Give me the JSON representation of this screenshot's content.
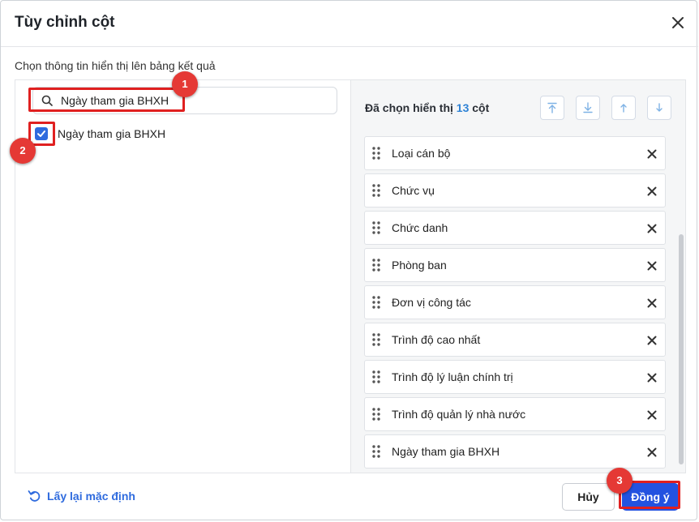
{
  "dialog": {
    "title": "Tùy chỉnh cột",
    "close_icon": "close-icon",
    "subtitle": "Chọn thông tin hiển thị lên bảng kết quả"
  },
  "left_panel": {
    "search": {
      "value": "Ngày tham gia BHXH",
      "icon": "search-icon"
    },
    "results": [
      {
        "label": "Ngày tham gia BHXH",
        "checked": true
      }
    ]
  },
  "right_panel": {
    "header_prefix": "Đã chọn hiển thị",
    "count": "13",
    "header_suffix": "cột",
    "move_buttons": [
      "move-to-top-icon",
      "move-to-bottom-icon",
      "move-up-icon",
      "move-down-icon"
    ],
    "selected_columns": [
      "Loại cán bộ",
      "Chức vụ",
      "Chức danh",
      "Phòng ban",
      "Đơn vị công tác",
      "Trình độ cao nhất",
      "Trình độ lý luận chính trị",
      "Trình độ quản lý nhà nước",
      "Ngày tham gia BHXH"
    ]
  },
  "footer": {
    "reset_label": "Lấy lại mặc định",
    "cancel_label": "Hủy",
    "ok_label": "Đồng ý"
  },
  "annotations": [
    "1",
    "2",
    "3"
  ],
  "colors": {
    "accent": "#2352e0",
    "link": "#2f6bde",
    "count": "#2f83d6",
    "annotation": "#e53935"
  }
}
